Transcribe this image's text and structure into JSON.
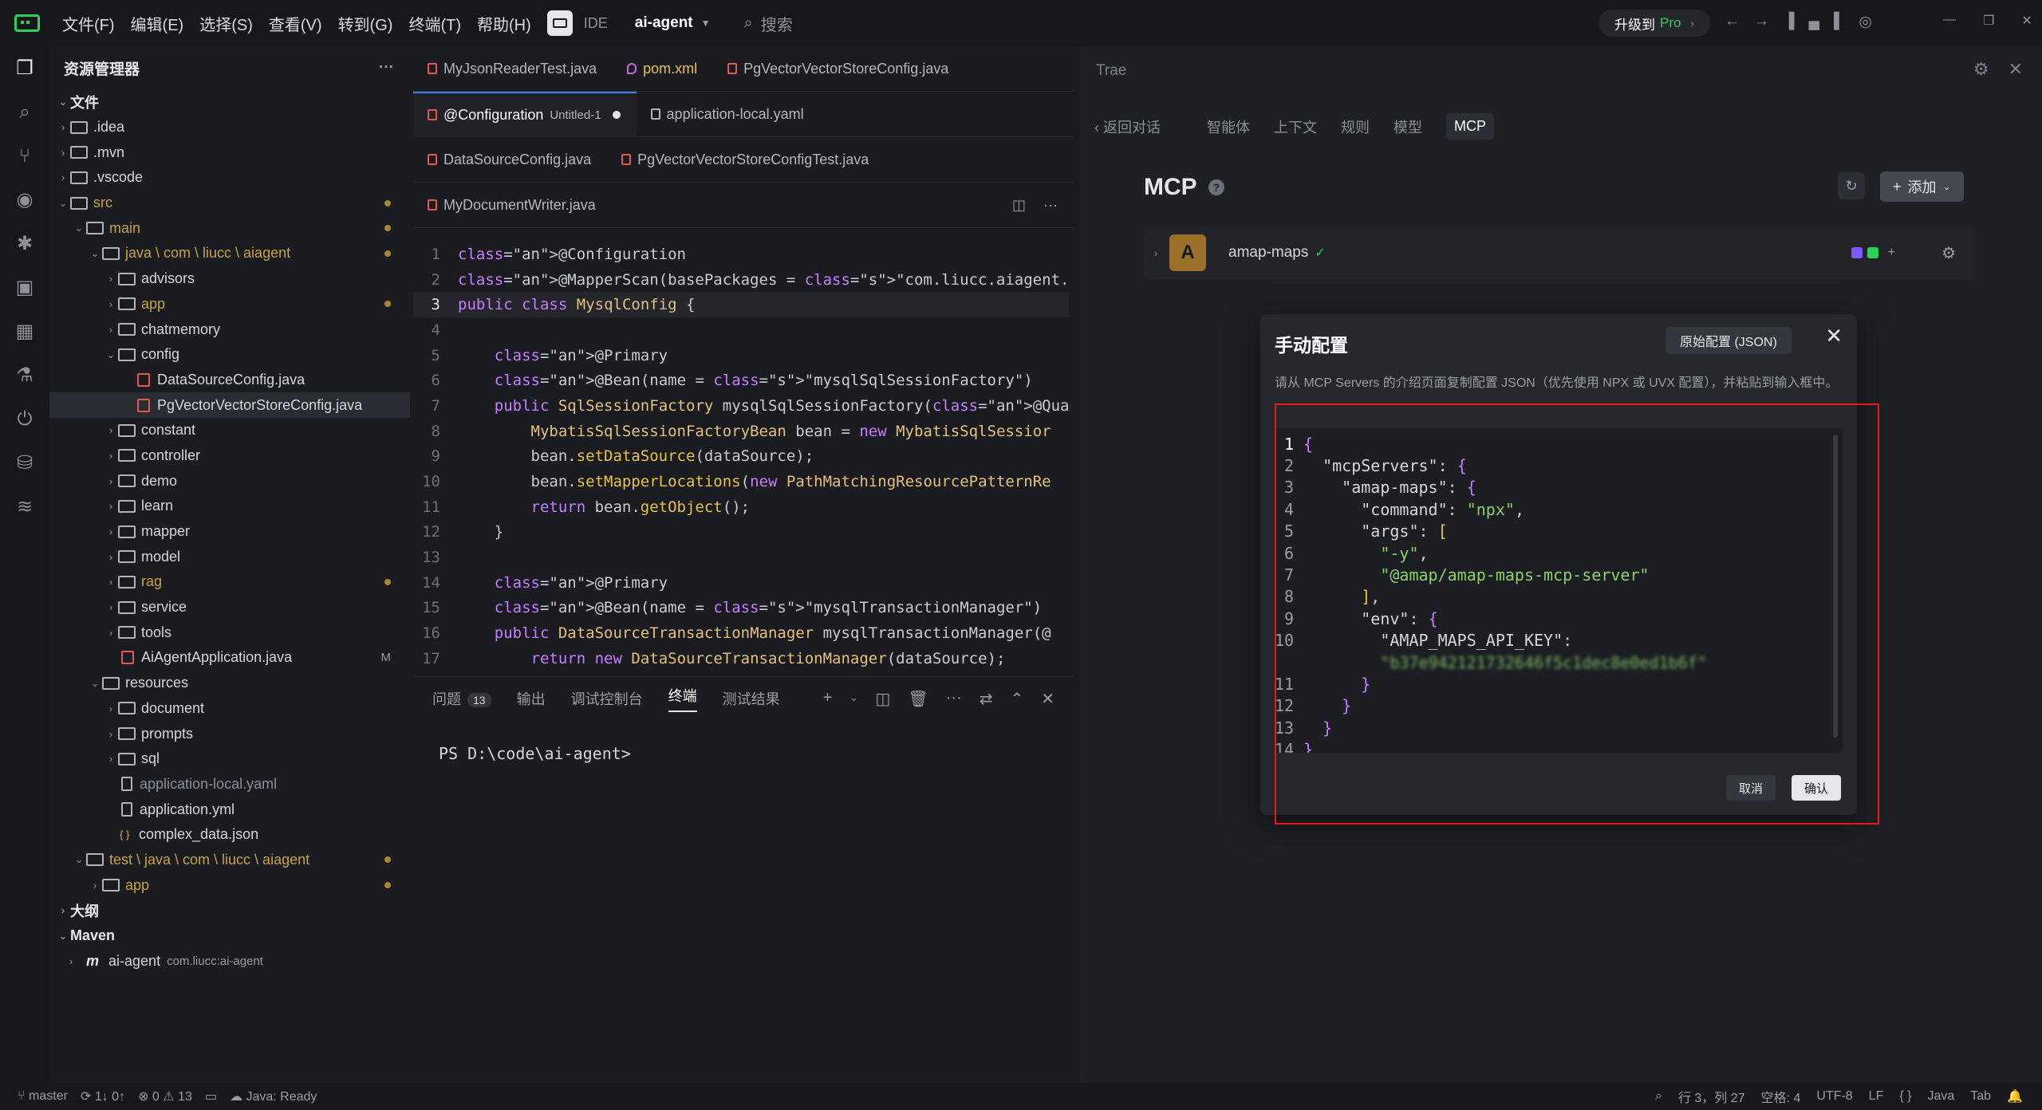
{
  "titlebar": {
    "menus": [
      "文件(F)",
      "编辑(E)",
      "选择(S)",
      "查看(V)",
      "转到(G)",
      "终端(T)",
      "帮助(H)"
    ],
    "ide_label": "IDE",
    "project": "ai-agent",
    "search_placeholder": "搜索",
    "upgrade_label": "升级到",
    "upgrade_pro": "Pro"
  },
  "explorer": {
    "title": "资源管理器",
    "section_files": "文件",
    "tree": [
      {
        "label": ".idea",
        "indent": 0,
        "type": "folder"
      },
      {
        "label": ".mvn",
        "indent": 0,
        "type": "folder"
      },
      {
        "label": ".vscode",
        "indent": 0,
        "type": "folder"
      },
      {
        "label": "src",
        "indent": 0,
        "type": "folder-open",
        "mod": true
      },
      {
        "label": "main",
        "indent": 1,
        "type": "folder-open",
        "mod": true
      },
      {
        "label": "java \\ com \\ liucc \\ aiagent",
        "indent": 2,
        "type": "folder-open",
        "mod": true
      },
      {
        "label": "advisors",
        "indent": 3,
        "type": "folder"
      },
      {
        "label": "app",
        "indent": 3,
        "type": "folder",
        "mod": true
      },
      {
        "label": "chatmemory",
        "indent": 3,
        "type": "folder"
      },
      {
        "label": "config",
        "indent": 3,
        "type": "folder-open"
      },
      {
        "label": "DataSourceConfig.java",
        "indent": 4,
        "type": "java"
      },
      {
        "label": "PgVectorVectorStoreConfig.java",
        "indent": 4,
        "type": "java",
        "selected": true
      },
      {
        "label": "constant",
        "indent": 3,
        "type": "folder"
      },
      {
        "label": "controller",
        "indent": 3,
        "type": "folder"
      },
      {
        "label": "demo",
        "indent": 3,
        "type": "folder"
      },
      {
        "label": "learn",
        "indent": 3,
        "type": "folder"
      },
      {
        "label": "mapper",
        "indent": 3,
        "type": "folder"
      },
      {
        "label": "model",
        "indent": 3,
        "type": "folder"
      },
      {
        "label": "rag",
        "indent": 3,
        "type": "folder",
        "mod": true
      },
      {
        "label": "service",
        "indent": 3,
        "type": "folder"
      },
      {
        "label": "tools",
        "indent": 3,
        "type": "folder"
      },
      {
        "label": "AiAgentApplication.java",
        "indent": 3,
        "type": "java",
        "tag": "M"
      },
      {
        "label": "resources",
        "indent": 2,
        "type": "folder-open"
      },
      {
        "label": "document",
        "indent": 3,
        "type": "folder"
      },
      {
        "label": "prompts",
        "indent": 3,
        "type": "folder"
      },
      {
        "label": "sql",
        "indent": 3,
        "type": "folder"
      },
      {
        "label": "application-local.yaml",
        "indent": 3,
        "type": "yaml",
        "dim": true
      },
      {
        "label": "application.yml",
        "indent": 3,
        "type": "yaml"
      },
      {
        "label": "complex_data.json",
        "indent": 3,
        "type": "json"
      },
      {
        "label": "test \\ java \\ com \\ liucc \\ aiagent",
        "indent": 1,
        "type": "folder-open",
        "mod": true
      },
      {
        "label": "app",
        "indent": 2,
        "type": "folder",
        "mod": true
      }
    ],
    "section_outline": "大纲",
    "section_maven": "Maven",
    "maven_item": "ai-agent",
    "maven_sub": "com.liucc:ai-agent"
  },
  "editor": {
    "tabs_row1": [
      "MyJsonReaderTest.java",
      "pom.xml",
      "PgVectorVectorStoreConfig.java"
    ],
    "tabs_row2_active": "@Configuration",
    "tabs_row2_active_sub": "Untitled-1",
    "tabs_row2_other": "application-local.yaml",
    "tabs_row3": [
      "DataSourceConfig.java",
      "PgVectorVectorStoreConfigTest.java"
    ],
    "tabs_row4": "MyDocumentWriter.java",
    "lines": [
      "@Configuration",
      "@MapperScan(basePackages = \"com.liucc.aiagent.mapper.mysql\", sqlS",
      "public class MysqlConfig {",
      "",
      "    @Primary",
      "    @Bean(name = \"mysqlSqlSessionFactory\")",
      "    public SqlSessionFactory mysqlSqlSessionFactory(@Qualifier(\"m",
      "        MybatisSqlSessionFactoryBean bean = new MybatisSqlSessior",
      "        bean.setDataSource(dataSource);",
      "        bean.setMapperLocations(new PathMatchingResourcePatternRe",
      "        return bean.getObject();",
      "    }",
      "",
      "    @Primary",
      "    @Bean(name = \"mysqlTransactionManager\")",
      "    public DataSourceTransactionManager mysqlTransactionManager(@",
      "        return new DataSourceTransactionManager(dataSource);"
    ]
  },
  "panel": {
    "tabs": [
      "问题",
      "输出",
      "调试控制台",
      "终端",
      "测试结果"
    ],
    "problems_count": "13",
    "active_tab": "终端",
    "terminal_prompt": "PS D:\\code\\ai-agent>"
  },
  "trae": {
    "title": "Trae",
    "back_label": "返回对话",
    "nav": [
      "智能体",
      "上下文",
      "规则",
      "模型",
      "MCP"
    ],
    "nav_active": "MCP",
    "heading": "MCP",
    "add_label": "添加",
    "mcp_server": {
      "avatar": "A",
      "name": "amap-maps"
    }
  },
  "dialog": {
    "title": "手动配置",
    "raw_button": "原始配置 (JSON)",
    "hint": "请从 MCP Servers 的介绍页面复制配置 JSON（优先使用 NPX 或 UVX 配置），并粘贴到输入框中。",
    "cancel_label": "取消",
    "confirm_label": "确认",
    "json_lines": [
      "{",
      "  \"mcpServers\": {",
      "    \"amap-maps\": {",
      "      \"command\": \"npx\",",
      "      \"args\": [",
      "        \"-y\",",
      "        \"@amap/amap-maps-mcp-server\"",
      "      ],",
      "      \"env\": {",
      "        \"AMAP_MAPS_API_KEY\":",
      "        \"b37e942121732646f5c1dec8e0ed1b6f\"",
      "      }",
      "    }",
      "  }",
      "}"
    ]
  },
  "statusbar": {
    "branch": "master",
    "sync": "1↓ 0↑",
    "errors": "0",
    "warnings": "13",
    "java_status": "Java: Ready",
    "position": "行 3，列 27",
    "spaces": "空格: 4",
    "encoding": "UTF-8",
    "eol": "LF",
    "lang_braces": "{ }",
    "language": "Java",
    "tab": "Tab"
  }
}
